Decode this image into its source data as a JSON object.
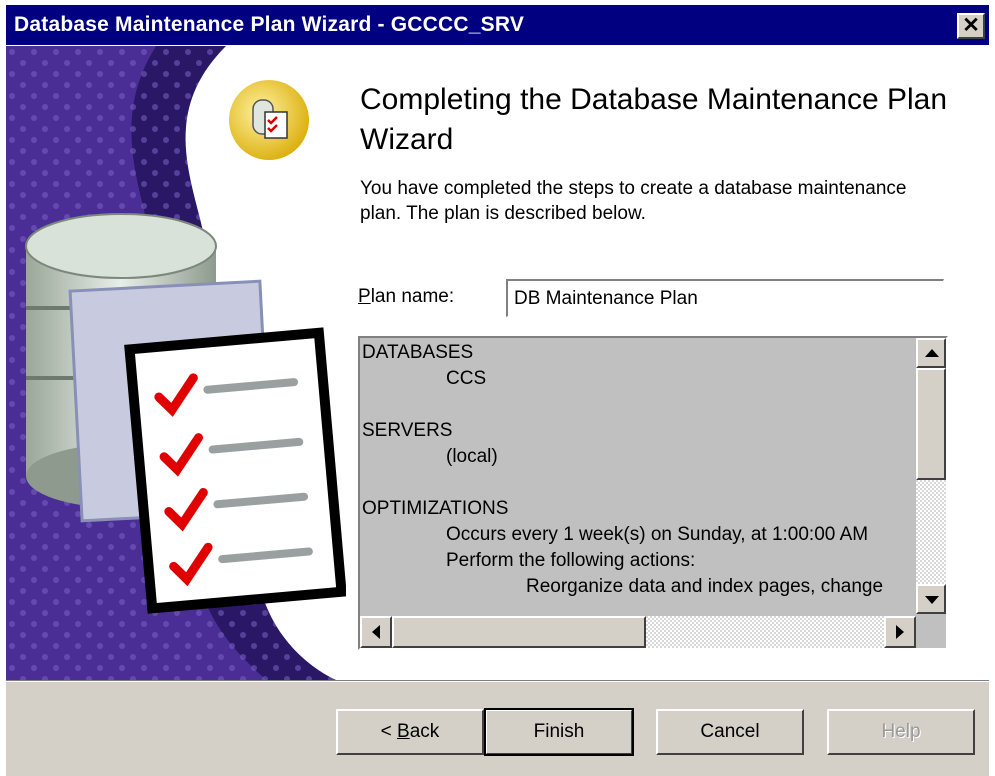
{
  "window": {
    "title": "Database Maintenance Plan Wizard - GCCCC_SRV",
    "close_glyph": "✕"
  },
  "art": {
    "icon": "database-checklist-icon",
    "colors": {
      "panel_dark": "#2a1866",
      "panel_mid": "#5a3da8",
      "check": "#e00000",
      "badge": "#e8c020"
    }
  },
  "page": {
    "heading": "Completing the Database Maintenance Plan Wizard",
    "description": "You have completed the steps to create a database maintenance plan. The plan is described below."
  },
  "plan": {
    "label_underlined": "P",
    "label_rest": "lan name:",
    "value": "DB Maintenance Plan"
  },
  "summary": {
    "databases_heading": "DATABASES",
    "databases_value": "CCS",
    "servers_heading": "SERVERS",
    "servers_value": "(local)",
    "optimizations_heading": "OPTIMIZATIONS",
    "schedule": "Occurs every 1 week(s) on Sunday, at 1:00:00 AM",
    "actions_intro": "Perform the following actions:",
    "action_1": "Reorganize data and index pages, change"
  },
  "buttons": {
    "back_prefix": "< ",
    "back_underlined": "B",
    "back_rest": "ack",
    "finish": "Finish",
    "cancel": "Cancel",
    "help": "Help"
  }
}
